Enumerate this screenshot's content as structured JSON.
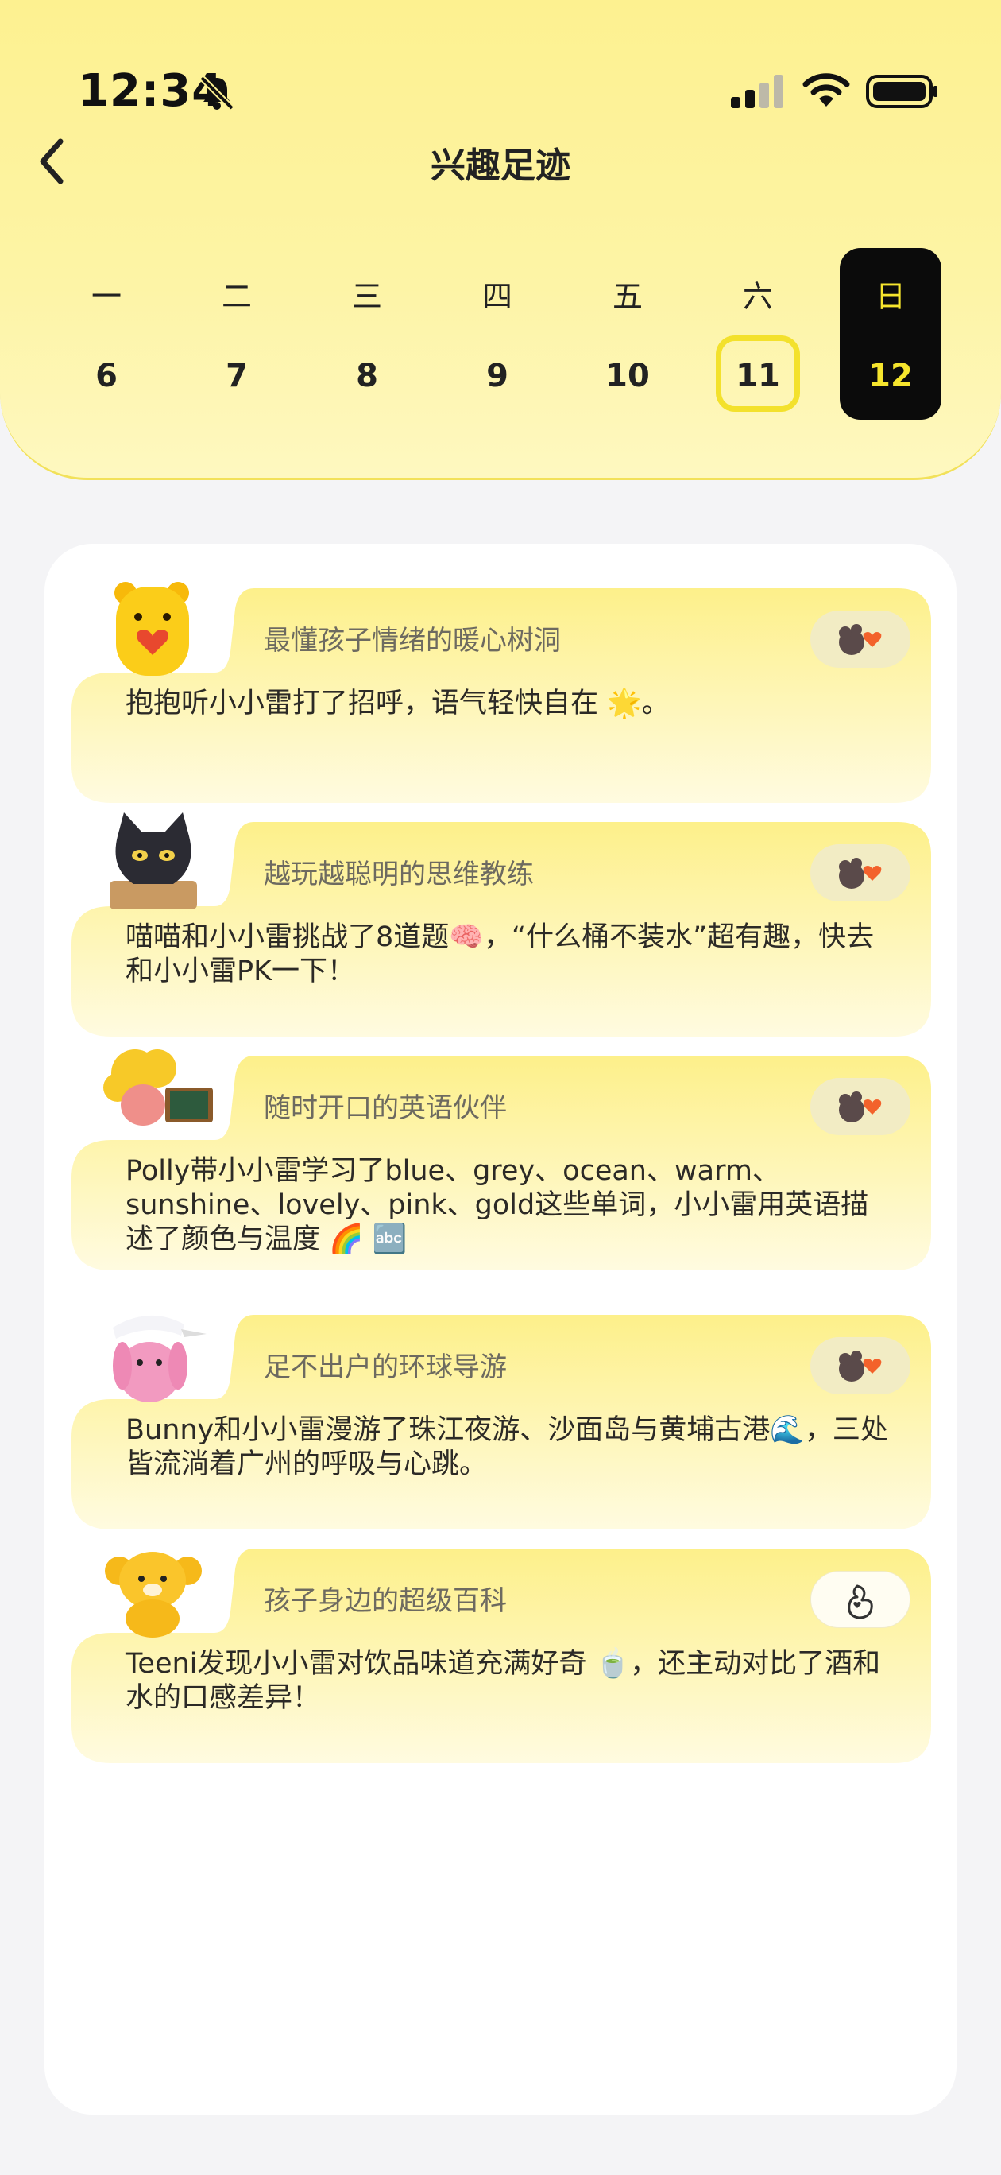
{
  "status_bar": {
    "time": "12:34"
  },
  "header": {
    "title": "兴趣足迹"
  },
  "week": [
    {
      "weekday": "一",
      "date": "6",
      "state": "normal"
    },
    {
      "weekday": "二",
      "date": "7",
      "state": "normal"
    },
    {
      "weekday": "三",
      "date": "8",
      "state": "normal"
    },
    {
      "weekday": "四",
      "date": "9",
      "state": "normal"
    },
    {
      "weekday": "五",
      "date": "10",
      "state": "normal"
    },
    {
      "weekday": "六",
      "date": "11",
      "state": "today"
    },
    {
      "weekday": "日",
      "date": "12",
      "state": "selected"
    }
  ],
  "cards": [
    {
      "avatar_icon": "bear-avatar-icon",
      "tag": "最懂孩子情绪的暖心树洞",
      "message": "抱抱听小小雷打了招呼，语气轻快自在 🌟。",
      "reaction_icon": "cluster-reaction-icon"
    },
    {
      "avatar_icon": "cat-avatar-icon",
      "tag": "越玩越聪明的思维教练",
      "message": "喵喵和小小雷挑战了8道题🧠，“什么桶不装水”超有趣，快去和小小雷PK一下！",
      "reaction_icon": "cluster-reaction-icon"
    },
    {
      "avatar_icon": "polly-avatar-icon",
      "tag": "随时开口的英语伙伴",
      "message": "Polly带小小雷学习了blue、grey、ocean、warm、sunshine、lovely、pink、gold这些单词，小小雷用英语描述了颜色与温度 🌈 🔤",
      "reaction_icon": "cluster-reaction-icon"
    },
    {
      "avatar_icon": "bunny-avatar-icon",
      "tag": "足不出户的环球导游",
      "message": "Bunny和小小雷漫游了珠江夜游、沙面岛与黄埔古港🌊，三处皆流淌着广州的呼吸与心跳。",
      "reaction_icon": "cluster-reaction-icon"
    },
    {
      "avatar_icon": "teeni-avatar-icon",
      "tag": "孩子身边的超级百科",
      "message": "Teeni发现小小雷对饮品味道充满好奇 🍵，还主动对比了酒和水的口感差异！",
      "reaction_icon": "hand-heart-icon"
    }
  ]
}
